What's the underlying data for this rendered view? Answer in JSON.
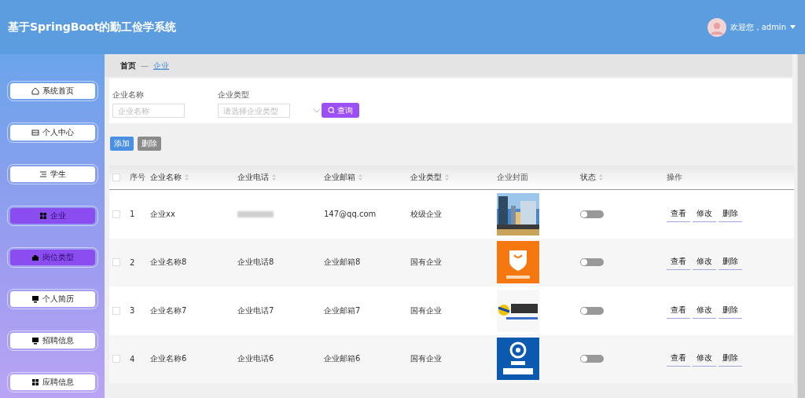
{
  "header": {
    "title": "基于SpringBoot的勤工俭学系统",
    "greeting": "欢迎您，admin"
  },
  "sidebar": {
    "items": [
      {
        "label": "系统首页",
        "kind": "home",
        "selected": false
      },
      {
        "label": "个人中心",
        "kind": "card",
        "selected": false
      },
      {
        "label": "学生",
        "kind": "list",
        "selected": false
      },
      {
        "label": "企业",
        "kind": "grid",
        "selected": true
      },
      {
        "label": "岗位类型",
        "kind": "bag",
        "selected": true
      },
      {
        "label": "个人简历",
        "kind": "monitor",
        "selected": false
      },
      {
        "label": "招聘信息",
        "kind": "monitor",
        "selected": false
      },
      {
        "label": "应聘信息",
        "kind": "grid",
        "selected": false
      }
    ]
  },
  "breadcrumb": {
    "home": "首页",
    "separator": "—",
    "current": "企业"
  },
  "search": {
    "fields": [
      {
        "label": "企业名称",
        "placeholder": "企业名称",
        "kind": "text"
      },
      {
        "label": "企业类型",
        "placeholder": "请选择企业类型",
        "kind": "select"
      }
    ],
    "button": "查询"
  },
  "actions": {
    "add": "添加",
    "delete": "删除"
  },
  "table": {
    "all_checked": false,
    "columns": [
      {
        "label": "序号",
        "sortable": false
      },
      {
        "label": "企业名称",
        "sortable": true
      },
      {
        "label": "企业电话",
        "sortable": true
      },
      {
        "label": "企业邮箱",
        "sortable": true
      },
      {
        "label": "企业类型",
        "sortable": true
      },
      {
        "label": "企业封面",
        "sortable": false
      },
      {
        "label": "状态",
        "sortable": true
      },
      {
        "label": "操作",
        "sortable": false
      }
    ],
    "rows": [
      {
        "index": "1",
        "name": "企业xx",
        "phone_blurred": true,
        "email": "147@qq.com",
        "type": "校级企业",
        "on": false,
        "checked": false,
        "actions": [
          "查看",
          "修改",
          "删除"
        ]
      },
      {
        "index": "2",
        "name": "企业名称8",
        "phone": "企业电话8",
        "email": "企业邮箱8",
        "type": "国有企业",
        "on": false,
        "checked": false,
        "actions": [
          "查看",
          "修改",
          "删除"
        ]
      },
      {
        "index": "3",
        "name": "企业名称7",
        "phone": "企业电话7",
        "email": "企业邮箱7",
        "type": "国有企业",
        "on": false,
        "checked": false,
        "actions": [
          "查看",
          "修改",
          "删除"
        ]
      },
      {
        "index": "4",
        "name": "企业名称6",
        "phone": "企业电话6",
        "email": "企业邮箱6",
        "type": "国有企业",
        "on": false,
        "checked": false,
        "actions": [
          "查看",
          "修改",
          "删除"
        ]
      }
    ]
  }
}
